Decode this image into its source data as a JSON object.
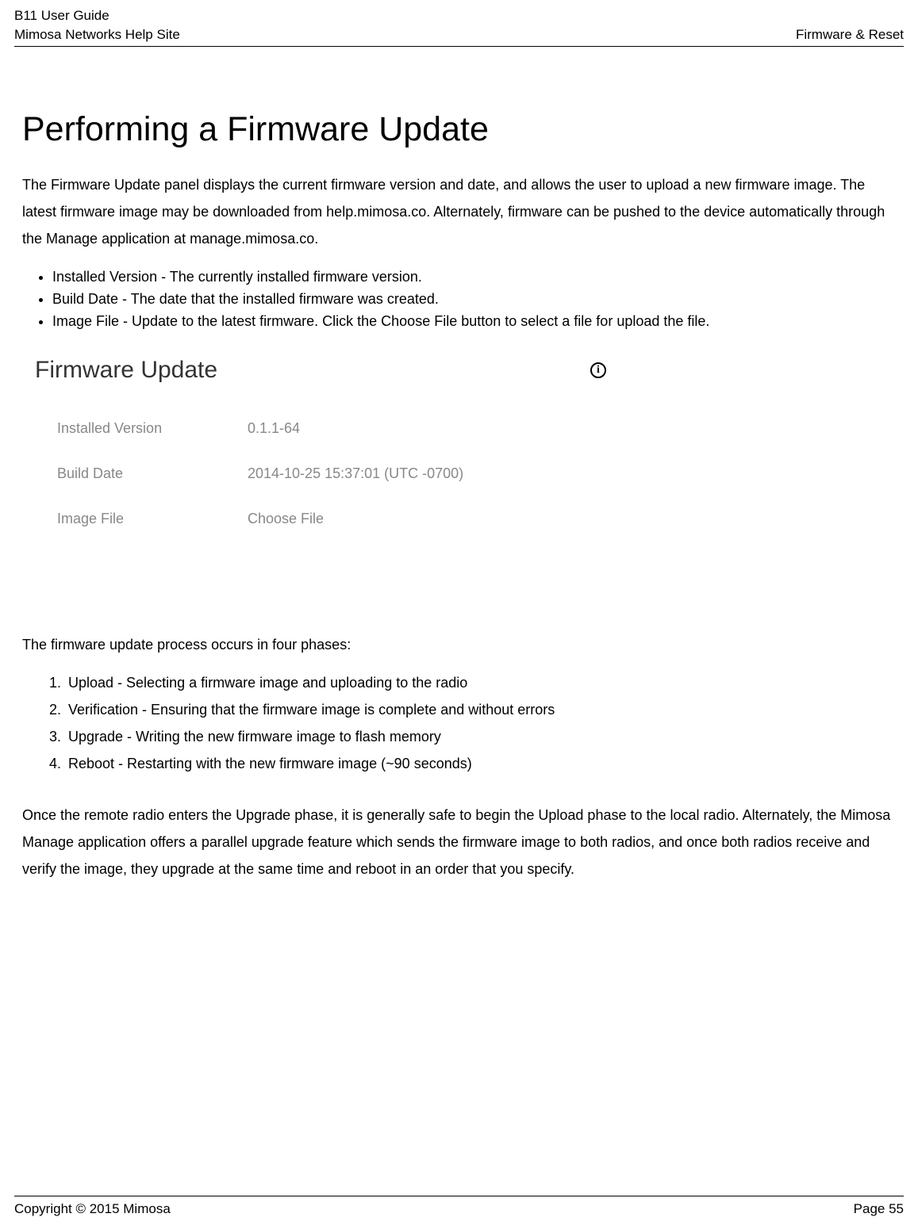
{
  "header": {
    "guide": "B11 User Guide",
    "site": "Mimosa Networks Help Site",
    "section": "Firmware & Reset"
  },
  "title": "Performing a Firmware Update",
  "intro": "The Firmware Update panel displays the current firmware version and date, and allows the user to upload a new firmware image. The latest firmware image may be downloaded from help.mimosa.co.  Alternately, firmware can be pushed to the device automatically through the Manage application at manage.mimosa.co.",
  "bullets": [
    "Installed Version - The currently installed firmware version.",
    "Build Date - The date that the installed firmware was created.",
    "Image File - Update to the latest firmware. Click the Choose File button to select a file for upload the file."
  ],
  "panel": {
    "title": "Firmware Update",
    "rows": [
      {
        "label": "Installed Version",
        "value": "0.1.1-64"
      },
      {
        "label": "Build Date",
        "value": "2014-10-25 15:37:01 (UTC -0700)"
      },
      {
        "label": "Image File",
        "value": "Choose File"
      }
    ]
  },
  "phases_intro": "The firmware update process occurs in four phases:",
  "phases": [
    "Upload - Selecting a firmware image and uploading to the radio",
    "Verification - Ensuring that the firmware image is complete and without errors",
    "Upgrade - Writing the new firmware image to flash memory",
    "Reboot - Restarting with the new firmware image (~90 seconds)"
  ],
  "closing": "Once the remote radio enters the Upgrade phase, it is generally safe to begin the Upload phase to the local radio. Alternately, the Mimosa Manage application offers a parallel upgrade feature which sends the firmware image to both radios, and once both radios receive and verify the image, they upgrade at the same time and reboot in an order that you specify.",
  "footer": {
    "copyright": "Copyright © 2015 Mimosa",
    "page": "Page 55"
  }
}
